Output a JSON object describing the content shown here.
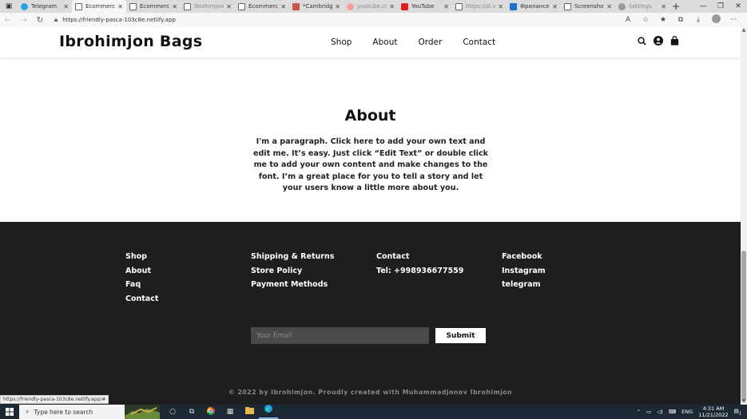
{
  "browser": {
    "tabs": [
      {
        "label": "Telegram",
        "active": false
      },
      {
        "label": "Ecommerce",
        "active": true
      },
      {
        "label": "Ecommerce",
        "active": false
      },
      {
        "label": "Ibrohimjon",
        "active": false
      },
      {
        "label": "Ecommerce",
        "active": false
      },
      {
        "label": "*Cambridge",
        "active": false
      },
      {
        "label": "youtube.com",
        "active": false
      },
      {
        "label": "YouTube",
        "active": false
      },
      {
        "label": "https://st.w",
        "active": false
      },
      {
        "label": "Фрилансер",
        "active": false
      },
      {
        "label": "Screenshot",
        "active": false
      },
      {
        "label": "Settings",
        "active": false
      }
    ],
    "url": "https://friendly-pasca-103c8e.netlify.app",
    "status_url": "https://friendly-pasca-103c8e.netlify.app/#"
  },
  "site": {
    "brand": "Ibrohimjon Bags",
    "nav": [
      "Shop",
      "About",
      "Order",
      "Contact"
    ],
    "about": {
      "title": "About",
      "text": "I'm a paragraph. Click here to add your own text and edit me. It’s easy. Just click “Edit Text” or double click me to add your own content and make changes to the font. I’m a great place for you to tell a story and let your users know a little more about you."
    },
    "footer": {
      "col1": [
        "Shop",
        "About",
        "Faq",
        "Contact"
      ],
      "col2": [
        "Shipping & Returns",
        "Store Policy",
        "Payment Methods"
      ],
      "col3": [
        "Contact",
        "Tel: +998936677559"
      ],
      "col4": [
        "Facebook",
        "Instagram",
        "telegram"
      ],
      "email_placeholder": "Your Email",
      "submit_label": "Submit",
      "copyright": "© 2022 by Ibrohimjon. Proudly created with Muhammadjonov Ibrohimjon"
    }
  },
  "taskbar": {
    "search_placeholder": "Type here to search",
    "language": "ENG",
    "time": "4:31 AM",
    "date": "11/21/2022",
    "notification_count": "1"
  }
}
